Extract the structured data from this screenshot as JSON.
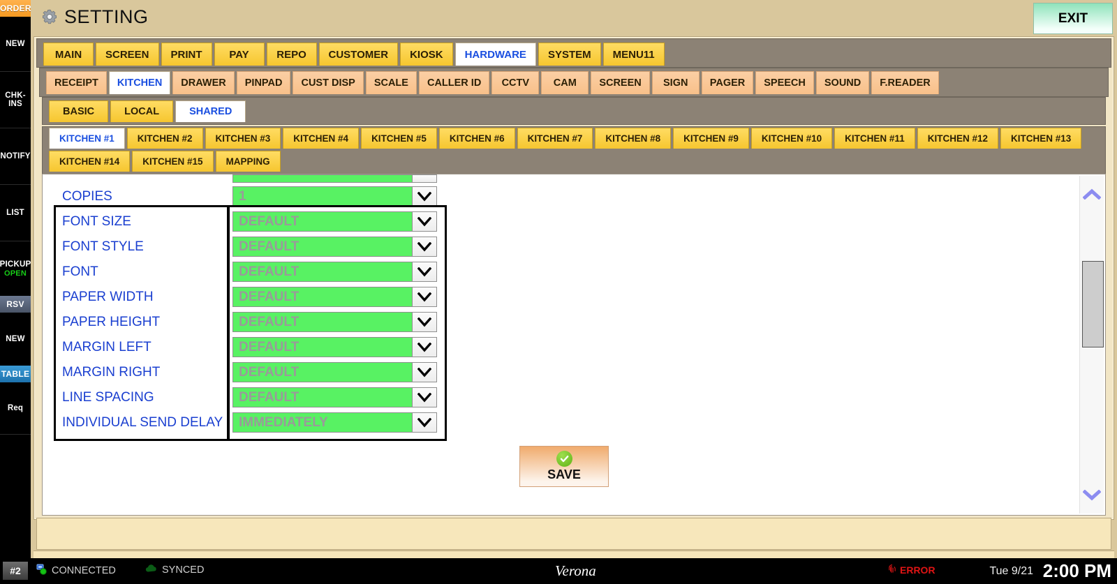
{
  "header": {
    "title": "SETTING",
    "gear_icon": "gear-icon",
    "exit_label": "EXIT"
  },
  "sidebar": {
    "sections": [
      {
        "type": "header",
        "label": "ORDER",
        "style": "order"
      },
      {
        "type": "item",
        "label": "NEW"
      },
      {
        "type": "item",
        "label": "CHK-INS"
      },
      {
        "type": "item",
        "label": "NOTIFY"
      },
      {
        "type": "item",
        "label": "LIST"
      },
      {
        "type": "item",
        "label": "PICKUP",
        "sub": "OPEN"
      },
      {
        "type": "header",
        "label": "RSV",
        "style": "rsv"
      },
      {
        "type": "item",
        "label": "NEW"
      },
      {
        "type": "header",
        "label": "TABLE",
        "style": "table"
      },
      {
        "type": "item",
        "label": "Req"
      }
    ]
  },
  "tabs_level1": {
    "items": [
      "MAIN",
      "SCREEN",
      "PRINT",
      "PAY",
      "REPO",
      "CUSTOMER",
      "KIOSK",
      "HARDWARE",
      "SYSTEM",
      "MENU11"
    ],
    "active": "HARDWARE"
  },
  "tabs_level2": {
    "items": [
      "RECEIPT",
      "KITCHEN",
      "DRAWER",
      "PINPAD",
      "CUST DISP",
      "SCALE",
      "CALLER ID",
      "CCTV",
      "CAM",
      "SCREEN",
      "SIGN",
      "PAGER",
      "SPEECH",
      "SOUND",
      "F.READER"
    ],
    "active": "KITCHEN"
  },
  "tabs_level3": {
    "items": [
      "BASIC",
      "LOCAL",
      "SHARED"
    ],
    "active": "SHARED"
  },
  "tabs_level4": {
    "items": [
      "KITCHEN #1",
      "KITCHEN #2",
      "KITCHEN #3",
      "KITCHEN #4",
      "KITCHEN #5",
      "KITCHEN #6",
      "KITCHEN #7",
      "KITCHEN #8",
      "KITCHEN #9",
      "KITCHEN #10",
      "KITCHEN #11",
      "KITCHEN #12",
      "KITCHEN #13",
      "KITCHEN #14",
      "KITCHEN #15",
      "MAPPING"
    ],
    "active": "KITCHEN #1"
  },
  "form": {
    "rows": [
      {
        "label": "COPIES",
        "value": "1"
      },
      {
        "label": "FONT SIZE",
        "value": "DEFAULT"
      },
      {
        "label": "FONT STYLE",
        "value": "DEFAULT"
      },
      {
        "label": "FONT",
        "value": "DEFAULT"
      },
      {
        "label": "PAPER WIDTH",
        "value": "DEFAULT"
      },
      {
        "label": "PAPER HEIGHT",
        "value": "DEFAULT"
      },
      {
        "label": "MARGIN LEFT",
        "value": "DEFAULT"
      },
      {
        "label": "MARGIN RIGHT",
        "value": "DEFAULT"
      },
      {
        "label": "LINE SPACING",
        "value": "DEFAULT"
      },
      {
        "label": "INDIVIDUAL SEND DELAY",
        "value": "IMMEDIATELY"
      }
    ],
    "save_label": "SAVE",
    "save_icon": "check-circle-icon"
  },
  "scrollbar": {
    "up_icon": "chevron-up-icon",
    "down_icon": "chevron-down-icon"
  },
  "statusbar": {
    "terminal": "#2",
    "connected": "CONNECTED",
    "connected_icon": "network-icon",
    "synced": "SYNCED",
    "synced_icon": "cloud-icon",
    "brand": "Verona",
    "error": "ERROR",
    "error_icon": "fingerprint-icon",
    "date": "Tue 9/21",
    "time": "2:00 PM"
  },
  "colors": {
    "tab_yellow": "#f6c62f",
    "tab_peach": "#f8c08a",
    "active_text_blue": "#1a4fe0",
    "label_blue": "#1a3fd0",
    "select_green": "#58f263",
    "exit_green": "#8fe3bb",
    "save_orange": "#f0ab6d",
    "error_red": "#e01414",
    "page_bg": "#d9c79c"
  }
}
